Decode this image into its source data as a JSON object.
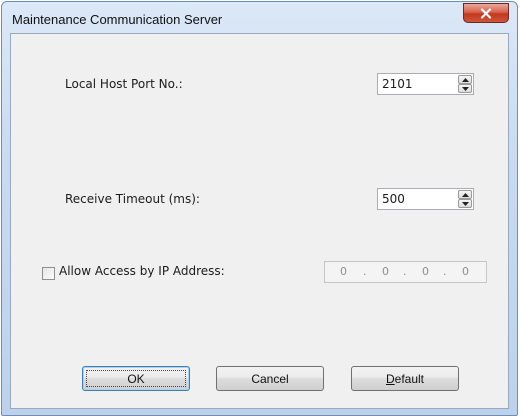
{
  "window": {
    "title": "Maintenance Communication Server",
    "close_icon": "close-x-icon"
  },
  "fields": {
    "local_port_label": "Local Host Port No.:",
    "local_port_value": "2101",
    "receive_timeout_label": "Receive Timeout (ms):",
    "receive_timeout_value": "500",
    "allow_access_label": "Allow Access by IP Address:",
    "allow_access_checked": false,
    "ip_octets": [
      "0",
      "0",
      "0",
      "0"
    ]
  },
  "buttons": {
    "ok": "OK",
    "cancel": "Cancel",
    "default_first": "D",
    "default_rest": "efault"
  },
  "colors": {
    "titlebar": "#c7daf1",
    "close_button": "#c2381f",
    "client_bg": "#f0f0f0"
  }
}
